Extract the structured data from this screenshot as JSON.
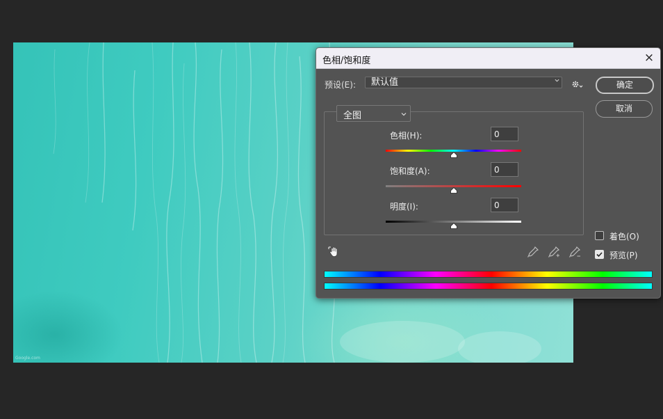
{
  "canvas": {
    "watermark": "Google.com"
  },
  "dialog": {
    "title": "色相/饱和度",
    "close_icon": "×",
    "preset_label": "预设(E):",
    "preset_value": "默认值",
    "channel_value": "全图",
    "sliders": [
      {
        "label": "色相(H):",
        "value": "0",
        "position": 0.5
      },
      {
        "label": "饱和度(A):",
        "value": "0",
        "position": 0.5
      },
      {
        "label": "明度(I):",
        "value": "0",
        "position": 0.5
      }
    ],
    "buttons": {
      "ok": "确定",
      "cancel": "取消"
    },
    "options": {
      "colorize": {
        "label": "着色(O)",
        "checked": false
      },
      "preview": {
        "label": "预览(P)",
        "checked": true
      }
    },
    "icons": [
      "hand-adjust-icon",
      "eyedropper-icon",
      "eyedropper-plus-icon",
      "eyedropper-minus-icon",
      "gear-icon",
      "chevron-down-icon",
      "close-icon"
    ],
    "colors": {
      "dialog_bg": "#535353",
      "titlebar_bg": "#f0eef5",
      "canvas_teal": "#3fcbc0"
    }
  }
}
